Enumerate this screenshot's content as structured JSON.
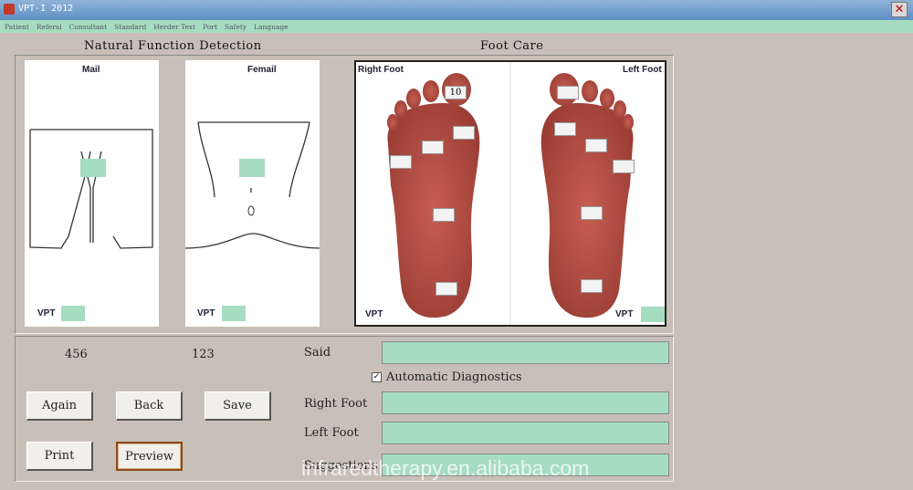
{
  "window": {
    "title": "VPT-I 2012",
    "close_glyph": "✕"
  },
  "menu": [
    "Patient",
    "Referal",
    "Consultant",
    "Standard",
    "Herder Text",
    "Port",
    "Safety",
    "Language"
  ],
  "sections": {
    "natural_function": "Natural Function Detection",
    "foot_care": "Foot Care"
  },
  "cards": {
    "male": {
      "label": "Mail",
      "vpt": "VPT"
    },
    "female": {
      "label": "Femail",
      "vpt": "VPT"
    },
    "feet": {
      "right_label": "Right Foot",
      "left_label": "Left Foot",
      "vpt_left": "VPT",
      "vpt_right": "VPT",
      "marker_value": "10"
    }
  },
  "values": {
    "male_value": "456",
    "female_value": "123"
  },
  "form": {
    "said_label": "Said",
    "automatic_label": "Automatic Diagnostics",
    "automatic_checked": "✓",
    "right_foot_label": "Right Foot",
    "left_foot_label": "Left Foot",
    "suggestions_label": "Suggestions"
  },
  "buttons": {
    "again": "Again",
    "back": "Back",
    "save": "Save",
    "print": "Print",
    "preview": "Preview"
  },
  "watermark": "infraredtherapy.en.alibaba.com",
  "colors": {
    "field_green": "#a6dcc0",
    "background": "#c8c0b8",
    "foot_fill": "#b8554a"
  }
}
